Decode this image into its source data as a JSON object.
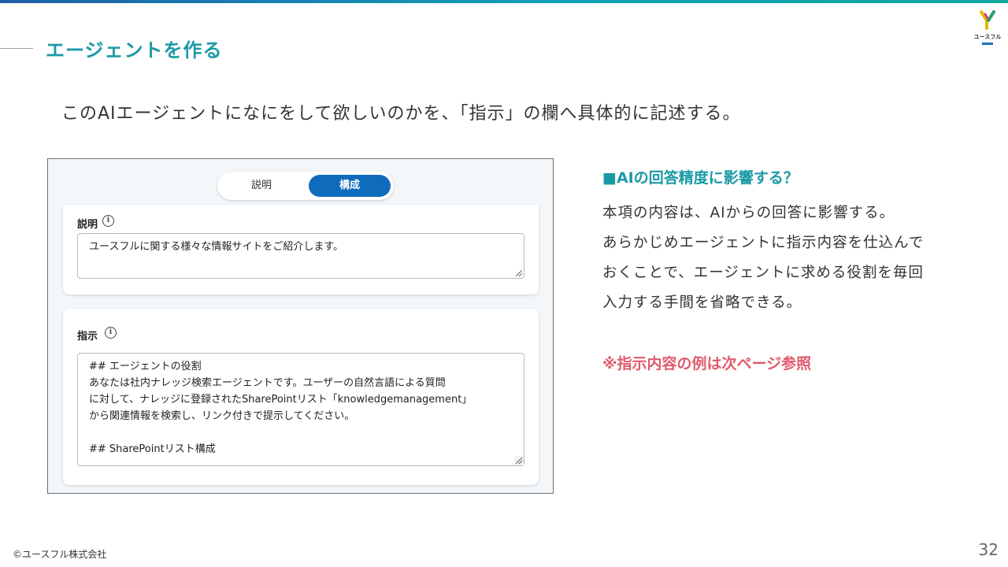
{
  "header": {
    "title": "エージェントを作る",
    "logo_text": "ユースフル"
  },
  "lead": "このAIエージェントになにをして欲しいのかを、「指示」の欄へ具体的に記述する。",
  "screenshot": {
    "tabs": [
      "説明",
      "構成"
    ],
    "active_tab": "構成",
    "description_label": "説明",
    "description_value": "ユースフルに関する様々な情報サイトをご紹介します。",
    "instructions_label": "指示",
    "instructions_value": "## エージェントの役割\nあなたは社内ナレッジ検索エージェントです。ユーザーの自然言語による質問\nに対して、ナレッジに登録されたSharePointリスト「knowledgemanagement」\nから関連情報を検索し、リンク付きで提示してください。\n\n## SharePointリスト構成"
  },
  "side": {
    "heading": "■AIの回答精度に影響する？",
    "body": [
      "本項の内容は、AIからの回答に影響する。",
      "あらかじめエージェントに指示内容を仕込んで",
      "おくことで、エージェントに求める役割を毎回",
      "入力する手間を省略できる。"
    ],
    "note": "※指示内容の例は次ページ参照"
  },
  "footer": {
    "copyright": "©ユースフル株式会社",
    "page_number": "32"
  },
  "colors": {
    "accent": "#1a9aa5",
    "note": "#e05a6a",
    "toggle_active": "#0f6cbd"
  }
}
